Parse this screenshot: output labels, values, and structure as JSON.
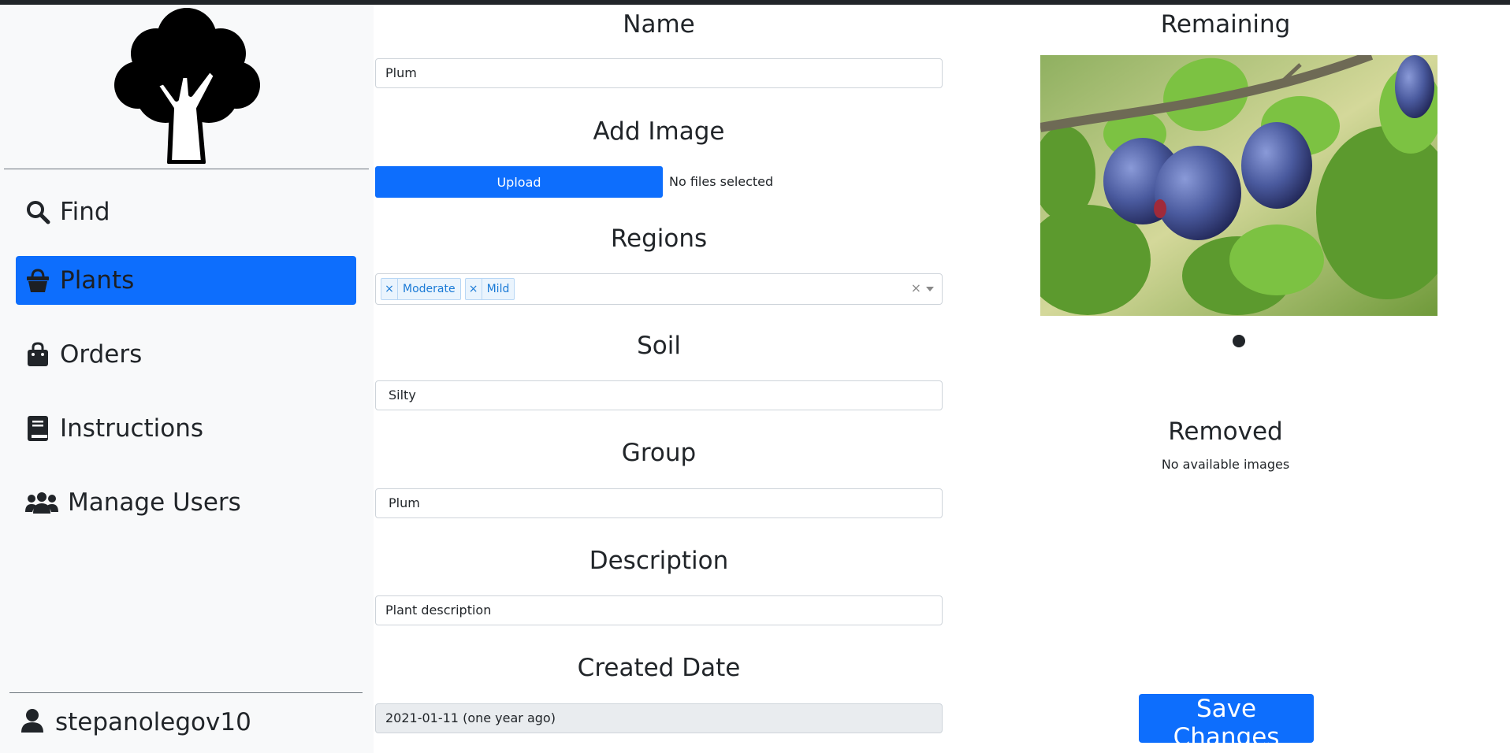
{
  "sidebar": {
    "items": [
      {
        "label": "Find",
        "icon": "search-icon"
      },
      {
        "label": "Plants",
        "icon": "basket-icon",
        "active": true
      },
      {
        "label": "Orders",
        "icon": "shopping-bag-icon"
      },
      {
        "label": "Instructions",
        "icon": "book-icon"
      },
      {
        "label": "Manage Users",
        "icon": "users-icon"
      }
    ],
    "user": {
      "name": "stepanolegov10",
      "icon": "user-icon"
    }
  },
  "form": {
    "name": {
      "title": "Name",
      "value": "Plum"
    },
    "add_image": {
      "title": "Add Image",
      "button_label": "Upload",
      "status": "No files selected"
    },
    "regions": {
      "title": "Regions",
      "tags": [
        "Moderate",
        "Mild"
      ],
      "tag_remove": "×",
      "clear": "×"
    },
    "soil": {
      "title": "Soil",
      "value": "Silty"
    },
    "group": {
      "title": "Group",
      "value": "Plum"
    },
    "description": {
      "title": "Description",
      "value": "Plant description"
    },
    "created_date": {
      "title": "Created Date",
      "value": "2021-01-11 (one year ago)"
    }
  },
  "images": {
    "remaining_title": "Remaining",
    "removed_title": "Removed",
    "removed_empty": "No available images"
  },
  "actions": {
    "save_label": "Save Changes"
  },
  "colors": {
    "primary": "#0d6efd",
    "sidebar_bg": "#f8f9fa",
    "text": "#212529"
  }
}
